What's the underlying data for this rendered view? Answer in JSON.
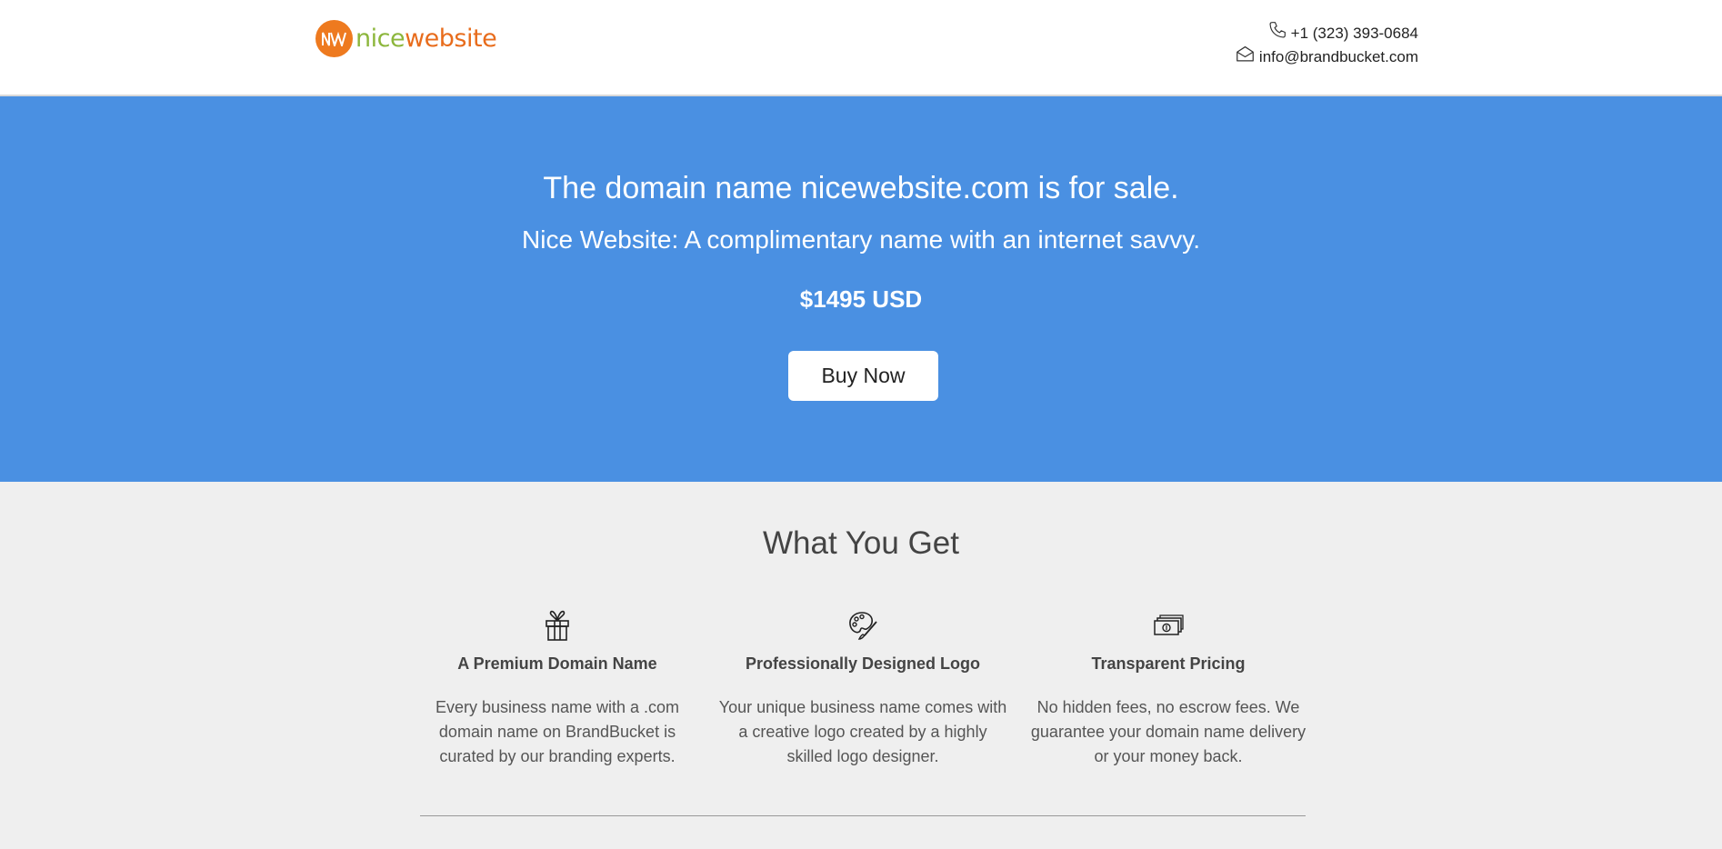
{
  "header": {
    "logo": {
      "part1": "nice",
      "part2": "website",
      "icon": "nw-logo-icon"
    },
    "phone": {
      "icon": "phone-icon",
      "text": "+1 (323) 393-0684"
    },
    "email": {
      "icon": "mail-icon",
      "text": "info@brandbucket.com"
    }
  },
  "hero": {
    "title": "The domain name nicewebsite.com is for sale.",
    "subtitle": "Nice Website: A complimentary name with an internet savvy.",
    "price": "$1495 USD",
    "buy_label": "Buy Now",
    "background": "#4a90e2"
  },
  "what_you_get": {
    "title": "What You Get",
    "features": [
      {
        "icon": "gift-icon",
        "title": "A Premium Domain Name",
        "text": "Every business name with a .com domain name on BrandBucket is curated by our branding experts."
      },
      {
        "icon": "palette-icon",
        "title": "Professionally Designed Logo",
        "text": "Your unique business name comes with a creative logo created by a highly skilled logo designer."
      },
      {
        "icon": "money-icon",
        "title": "Transparent Pricing",
        "text": "No hidden fees, no escrow fees. We guarantee your domain name delivery or your money back."
      }
    ]
  },
  "colors": {
    "accent": "#4a90e2",
    "logo_orange": "#ee7a1f",
    "logo_green": "#8cb63c"
  }
}
